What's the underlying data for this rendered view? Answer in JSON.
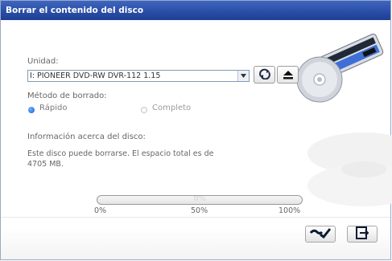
{
  "window": {
    "title": "Borrar el contenido del disco"
  },
  "drive": {
    "label": "Unidad:",
    "selected": "I: PIONEER DVD-RW  DVR-112 1.15",
    "refresh_icon": "refresh-icon",
    "eject_icon": "eject-icon"
  },
  "method": {
    "label": "Método de borrado:",
    "options": [
      {
        "label": "Rápido",
        "selected": true
      },
      {
        "label": "Completo",
        "selected": false
      }
    ]
  },
  "info": {
    "heading": "Información acerca del disco:",
    "text_line1": "Este disco puede borrarse. El espacio total es de",
    "text_line2": "4705 MB."
  },
  "progress": {
    "value_percent": 0,
    "label": "0%",
    "ticks": [
      "0%",
      "50%",
      "100%"
    ]
  },
  "footer": {
    "ok_icon": "checkmark-icon",
    "exit_icon": "exit-icon"
  },
  "colors": {
    "titlebar": "#2a4fa8",
    "accent": "#1d5fd0"
  }
}
